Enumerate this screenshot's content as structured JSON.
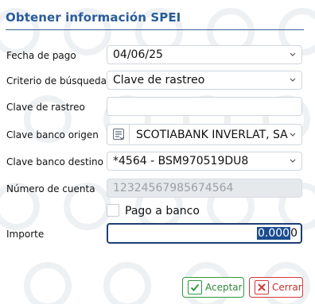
{
  "dialog": {
    "title": "Obtener información SPEI"
  },
  "form": {
    "fecha_pago": {
      "label": "Fecha de pago",
      "value": "04/06/25"
    },
    "criterio": {
      "label": "Criterio de búsqueda*",
      "value": "Clave de rastreo"
    },
    "clave_rastreo": {
      "label": "Clave de rastreo",
      "value": ""
    },
    "banco_origen": {
      "label": "Clave banco origen",
      "value": "SCOTIABANK INVERLAT, SA"
    },
    "banco_destino": {
      "label": "Clave banco destino",
      "value": "*4564 - BSM970519DU8"
    },
    "numero_cuenta": {
      "label": "Número de cuenta",
      "value": "12324567985674564"
    },
    "pago_banco": {
      "label": "Pago a banco",
      "checked": false
    },
    "importe": {
      "label": "Importe",
      "selected": "0.000",
      "rest": "0"
    }
  },
  "buttons": {
    "accept": "Aceptar",
    "cancel": "Cerrar"
  },
  "colors": {
    "title": "#2a5c9a",
    "accept": "#2f9a3c",
    "cancel": "#cf3a3a",
    "focus": "#1c3f73"
  }
}
